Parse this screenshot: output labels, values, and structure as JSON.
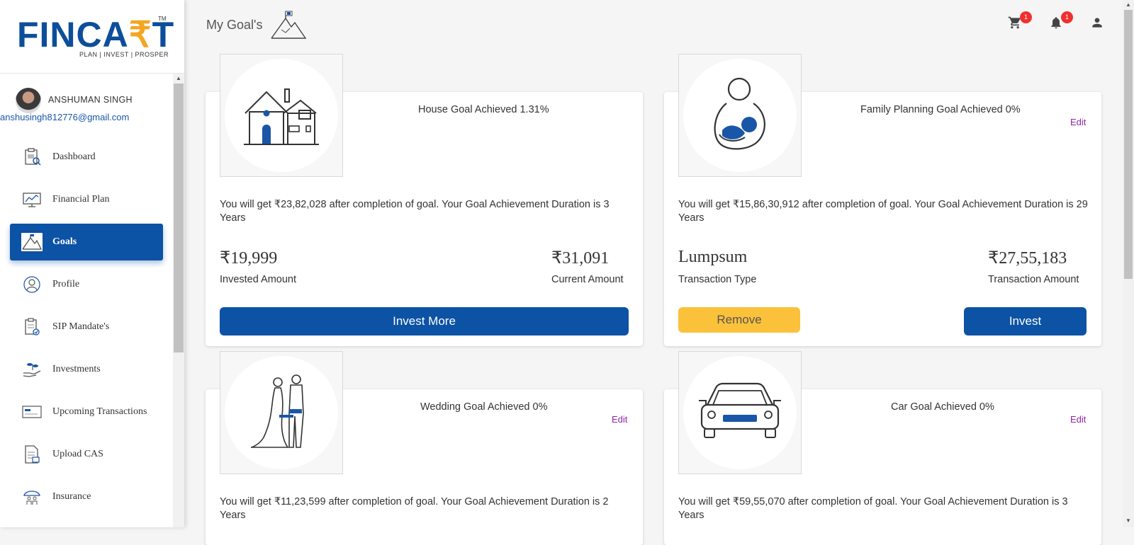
{
  "brand": {
    "logo_main": "FINCA",
    "logo_accent": "₹",
    "logo_end": "T",
    "logo_tm": "TM",
    "tagline": "PLAN | INVEST | PROSPER",
    "colors": {
      "primary": "#0c52a5",
      "accent": "#f4a521",
      "edit": "#8e24aa",
      "badge": "#f0302f",
      "warning": "#fbc13a"
    }
  },
  "user": {
    "name": "ANSHUMAN SINGH",
    "email": "anshusingh812776@gmail.com"
  },
  "sidebar": {
    "items": [
      {
        "label": "Dashboard",
        "icon": "dashboard-icon",
        "active": false
      },
      {
        "label": "Financial Plan",
        "icon": "chart-icon",
        "active": false
      },
      {
        "label": "Goals",
        "icon": "mountain-flag-icon",
        "active": true
      },
      {
        "label": "Profile",
        "icon": "user-circle-icon",
        "active": false
      },
      {
        "label": "SIP Mandate's",
        "icon": "clipboard-icon",
        "active": false
      },
      {
        "label": "Investments",
        "icon": "hand-plant-icon",
        "active": false
      },
      {
        "label": "Upcoming Transactions",
        "icon": "card-icon",
        "active": false
      },
      {
        "label": "Upload CAS",
        "icon": "document-icon",
        "active": false
      },
      {
        "label": "Insurance",
        "icon": "umbrella-family-icon",
        "active": false
      }
    ]
  },
  "header": {
    "title": "My Goal's",
    "cart_count": "1",
    "notification_count": "1"
  },
  "goals": [
    {
      "title": "House Goal Achieved 1.31%",
      "icon": "house-icon",
      "description": "You will get ₹23,82,028 after completion of goal. Your Goal Achievement Duration is 3 Years",
      "left_value": "₹19,999",
      "left_label": "Invested Amount",
      "right_value": "₹31,091",
      "right_label": "Current Amount",
      "primary_button": "Invest More"
    },
    {
      "title": "Family Planning Goal Achieved 0%",
      "icon": "mother-child-icon",
      "edit": "Edit",
      "description": "You will get ₹15,86,30,912 after completion of goal. Your Goal Achievement Duration is 29 Years",
      "left_value": "Lumpsum",
      "left_label": "Transaction Type",
      "right_value": "₹27,55,183",
      "right_label": "Transaction Amount",
      "secondary_button": "Remove",
      "primary_button": "Invest"
    },
    {
      "title": "Wedding Goal Achieved 0%",
      "icon": "wedding-couple-icon",
      "edit": "Edit",
      "description": "You will get ₹11,23,599 after completion of goal. Your Goal Achievement Duration is 2 Years"
    },
    {
      "title": "Car Goal Achieved 0%",
      "icon": "car-icon",
      "edit": "Edit",
      "description": "You will get ₹59,55,070 after completion of goal. Your Goal Achievement Duration is 3 Years"
    }
  ]
}
